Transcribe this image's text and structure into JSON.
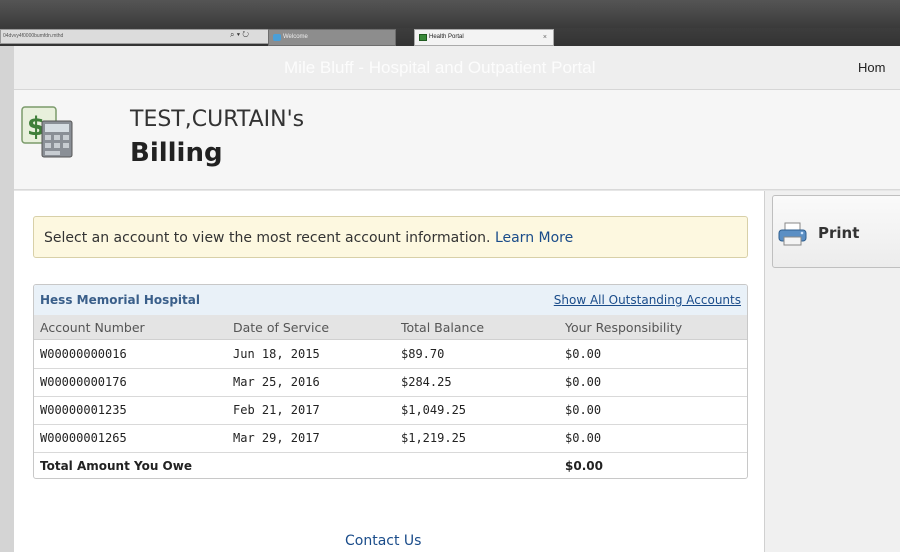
{
  "browser": {
    "address": "04dvvy4f0000bumfdn.mthd",
    "address_controls": "⌕ ▾ ↻",
    "tabs": [
      {
        "label": "Welcome"
      },
      {
        "label": "Health Portal",
        "close": "×"
      }
    ]
  },
  "header": {
    "site_title": "Mile Bluff - Hospital and Outpatient Portal",
    "home_link": "Hom"
  },
  "title": {
    "patient_name": "TEST,CURTAIN's",
    "page_title": "Billing"
  },
  "info": {
    "message": "Select an account to view the most recent account information. ",
    "learn_more": "Learn More"
  },
  "print": {
    "label": "Print"
  },
  "accounts": {
    "hospital": "Hess Memorial Hospital",
    "show_all": "Show All Outstanding Accounts",
    "columns": [
      "Account Number",
      "Date of Service",
      "Total Balance",
      "Your Responsibility"
    ],
    "rows": [
      [
        "W00000000016",
        "Jun 18, 2015",
        "$89.70",
        "$0.00"
      ],
      [
        "W00000000176",
        "Mar 25, 2016",
        "$284.25",
        "$0.00"
      ],
      [
        "W00000001235",
        "Feb 21, 2017",
        "$1,049.25",
        "$0.00"
      ],
      [
        "W00000001265",
        "Mar 29, 2017",
        "$1,219.25",
        "$0.00"
      ]
    ],
    "total_label": "Total Amount You Owe",
    "total_value": "$0.00"
  },
  "footer": {
    "contact": "Contact Us"
  },
  "colors": {
    "link": "#1a4c8a",
    "info_bg": "#fdf8e0",
    "hospital_header": "#3a5f8a"
  }
}
